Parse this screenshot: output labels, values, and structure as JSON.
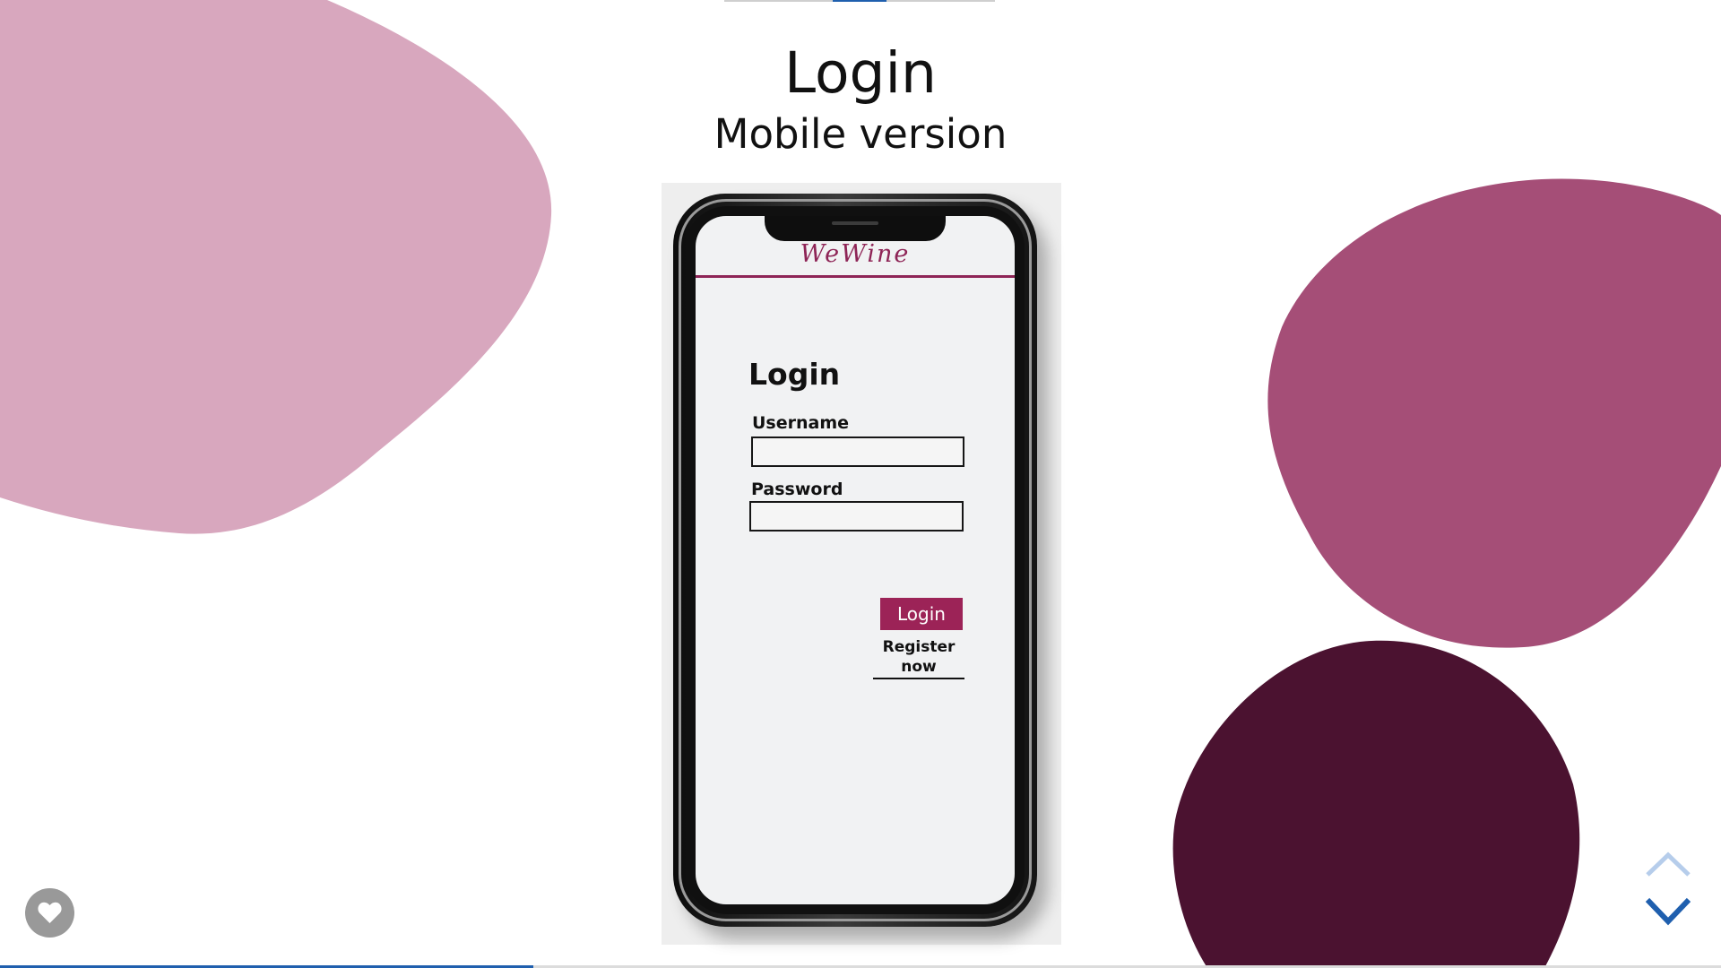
{
  "slide": {
    "title": "Login",
    "subtitle": "Mobile version"
  },
  "mockup": {
    "app_name": "WeWine",
    "login_heading": "Login",
    "username_label": "Username",
    "username_value": "",
    "password_label": "Password",
    "password_value": "",
    "login_button": "Login",
    "register_link": "Register now"
  },
  "theme": {
    "light_blob": "#d8a7be",
    "medium_blob": "#a54e77",
    "dark_blob": "#4b1230",
    "accent": "#9c2357",
    "nav_blue": "#1f5fae"
  },
  "icons": {
    "like": "heart-icon",
    "previous": "chevron-up-icon",
    "next": "chevron-down-icon"
  },
  "progress": {
    "fraction": 0.31
  }
}
